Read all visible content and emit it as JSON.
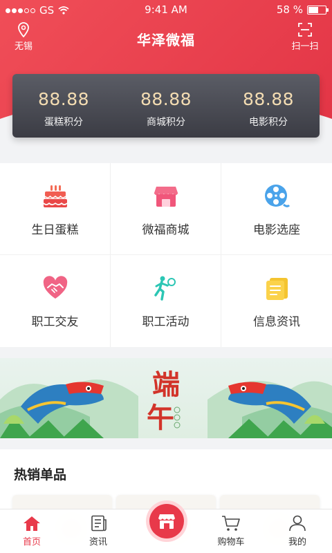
{
  "status_bar": {
    "carrier": "GS",
    "time": "9:41 AM",
    "battery": "58 %",
    "battery_level": 0.58
  },
  "header": {
    "location": "无锡",
    "title": "华泽微福",
    "scan_label": "扫一扫"
  },
  "points": [
    {
      "value": "88.88",
      "label": "蛋糕积分"
    },
    {
      "value": "88.88",
      "label": "商城积分"
    },
    {
      "value": "88.88",
      "label": "电影积分"
    }
  ],
  "services": [
    {
      "label": "生日蛋糕",
      "icon": "cake-icon"
    },
    {
      "label": "微福商城",
      "icon": "store-icon"
    },
    {
      "label": "电影选座",
      "icon": "film-reel-icon"
    },
    {
      "label": "职工交友",
      "icon": "heart-handshake-icon"
    },
    {
      "label": "职工活动",
      "icon": "tennis-player-icon"
    },
    {
      "label": "信息资讯",
      "icon": "news-document-icon"
    }
  ],
  "banner": {
    "text_top": "端",
    "text_bottom": "午"
  },
  "hot_section": {
    "title": "热销单品"
  },
  "tabbar": {
    "items": [
      {
        "label": "首页",
        "icon": "home-icon",
        "active": true
      },
      {
        "label": "资讯",
        "icon": "news-icon",
        "active": false
      },
      {
        "label": "",
        "icon": "store-icon",
        "active": false
      },
      {
        "label": "购物车",
        "icon": "cart-icon",
        "active": false
      },
      {
        "label": "我的",
        "icon": "user-icon",
        "active": false
      }
    ]
  },
  "colors": {
    "brand_red": "#e8394a",
    "points_gold": "#f3dcb2",
    "card_dark": "#3b3c44"
  }
}
